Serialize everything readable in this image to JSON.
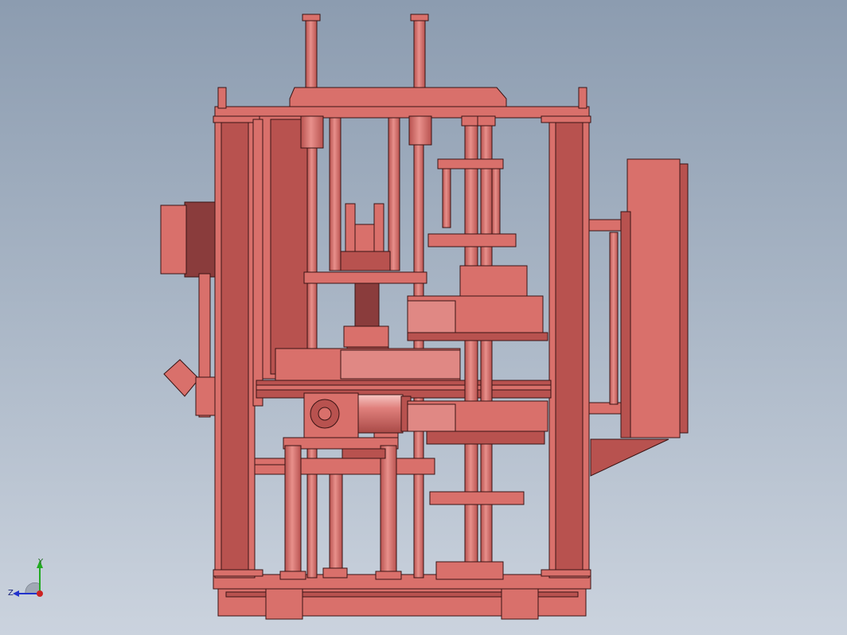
{
  "viewport": {
    "background_top": "#8c9cb0",
    "background_bottom": "#cbd3de"
  },
  "model": {
    "part_color": "#d9706b",
    "shade_color": "#b8524f",
    "edge_color": "#3a1414",
    "dark_color": "#8a3c3c"
  },
  "triad": {
    "y_label": "Y",
    "z_label": "Z",
    "y_color": "#22aa22",
    "z_color": "#2233cc",
    "origin_color": "#cc2222"
  }
}
